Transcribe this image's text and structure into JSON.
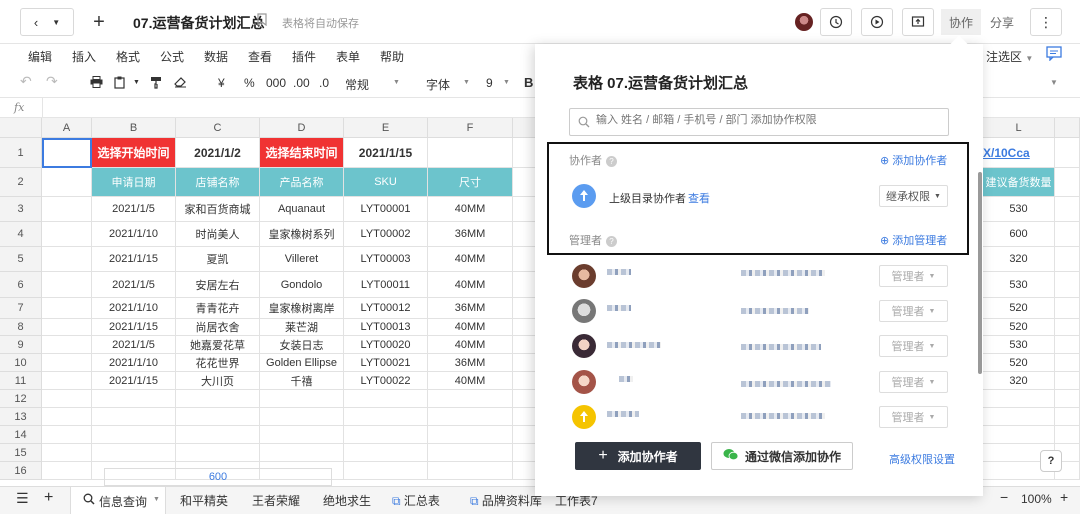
{
  "topbar": {
    "title": "07.运营备货计划汇总",
    "autosave": "表格将自动保存",
    "collab_tab": "协作",
    "share_tab": "分享"
  },
  "menu": [
    "编辑",
    "插入",
    "格式",
    "公式",
    "数据",
    "查看",
    "插件",
    "表单",
    "帮助"
  ],
  "menu_right": "注选区",
  "toolbar": {
    "currency": "¥",
    "percent": "%",
    "thousands": "000",
    "dec_add": ".00",
    "dec_sub": ".0",
    "format": "常规",
    "font": "字体",
    "size": "9",
    "bold": "B"
  },
  "fx": "fx",
  "grid": {
    "columns": [
      "A",
      "B",
      "C",
      "D",
      "E",
      "F",
      "L"
    ],
    "rows": [
      "1",
      "2",
      "3",
      "4",
      "5",
      "6",
      "7",
      "8",
      "9",
      "10",
      "11",
      "12",
      "13",
      "14",
      "15",
      "16"
    ],
    "row1": {
      "b": "选择开始时间",
      "c": "2021/1/2",
      "d": "选择结束时间",
      "e": "2021/1/15",
      "l": "X/10Cca"
    },
    "headers": [
      "申请日期",
      "店铺名称",
      "产品名称",
      "SKU",
      "尺寸"
    ],
    "l_header": "建议备货数量",
    "data": [
      [
        "2021/1/5",
        "家和百货商城",
        "Aquanaut",
        "LYT00001",
        "40MM",
        "530"
      ],
      [
        "2021/1/10",
        "时尚美人",
        "皇家橡树系列",
        "LYT00002",
        "36MM",
        "600"
      ],
      [
        "2021/1/15",
        "夏凯",
        "Villeret",
        "LYT00003",
        "40MM",
        "320"
      ],
      [
        "2021/1/5",
        "安居左右",
        "Gondolo",
        "LYT00011",
        "40MM",
        "530"
      ],
      [
        "2021/1/10",
        "青青花卉",
        "皇家橡树离岸",
        "LYT00012",
        "36MM",
        "520"
      ],
      [
        "2021/1/15",
        "尚居衣舍",
        "莱芒湖",
        "LYT00013",
        "40MM",
        "520"
      ],
      [
        "2021/1/5",
        "她嘉爱花草",
        "女装日志",
        "LYT00020",
        "40MM",
        "530"
      ],
      [
        "2021/1/10",
        "花花世界",
        "Golden Ellipse",
        "LYT00021",
        "36MM",
        "520"
      ],
      [
        "2021/1/15",
        "大川页",
        "千禧",
        "LYT00022",
        "40MM",
        "320"
      ]
    ],
    "row16_c": "600"
  },
  "sheets": [
    "信息查询",
    "和平精英",
    "王者荣耀",
    "绝地求生",
    "汇总表",
    "品牌资料库",
    "工作表7"
  ],
  "zoom": "100%",
  "panel": {
    "title": "表格 07.运营备货计划汇总",
    "search_placeholder": "输入 姓名 / 邮箱 / 手机号 / 部门 添加协作权限",
    "collaborators_label": "协作者",
    "add_collaborator_link": "添加协作者",
    "parent_dir_label": "上级目录协作者",
    "view_link": "查看",
    "inherit_btn": "继承权限",
    "managers_label": "管理者",
    "add_manager_link": "添加管理者",
    "member_role": "管理者",
    "add_btn": "添加协作者",
    "wechat_btn": "通过微信添加协作",
    "advanced_link": "高级权限设置"
  }
}
